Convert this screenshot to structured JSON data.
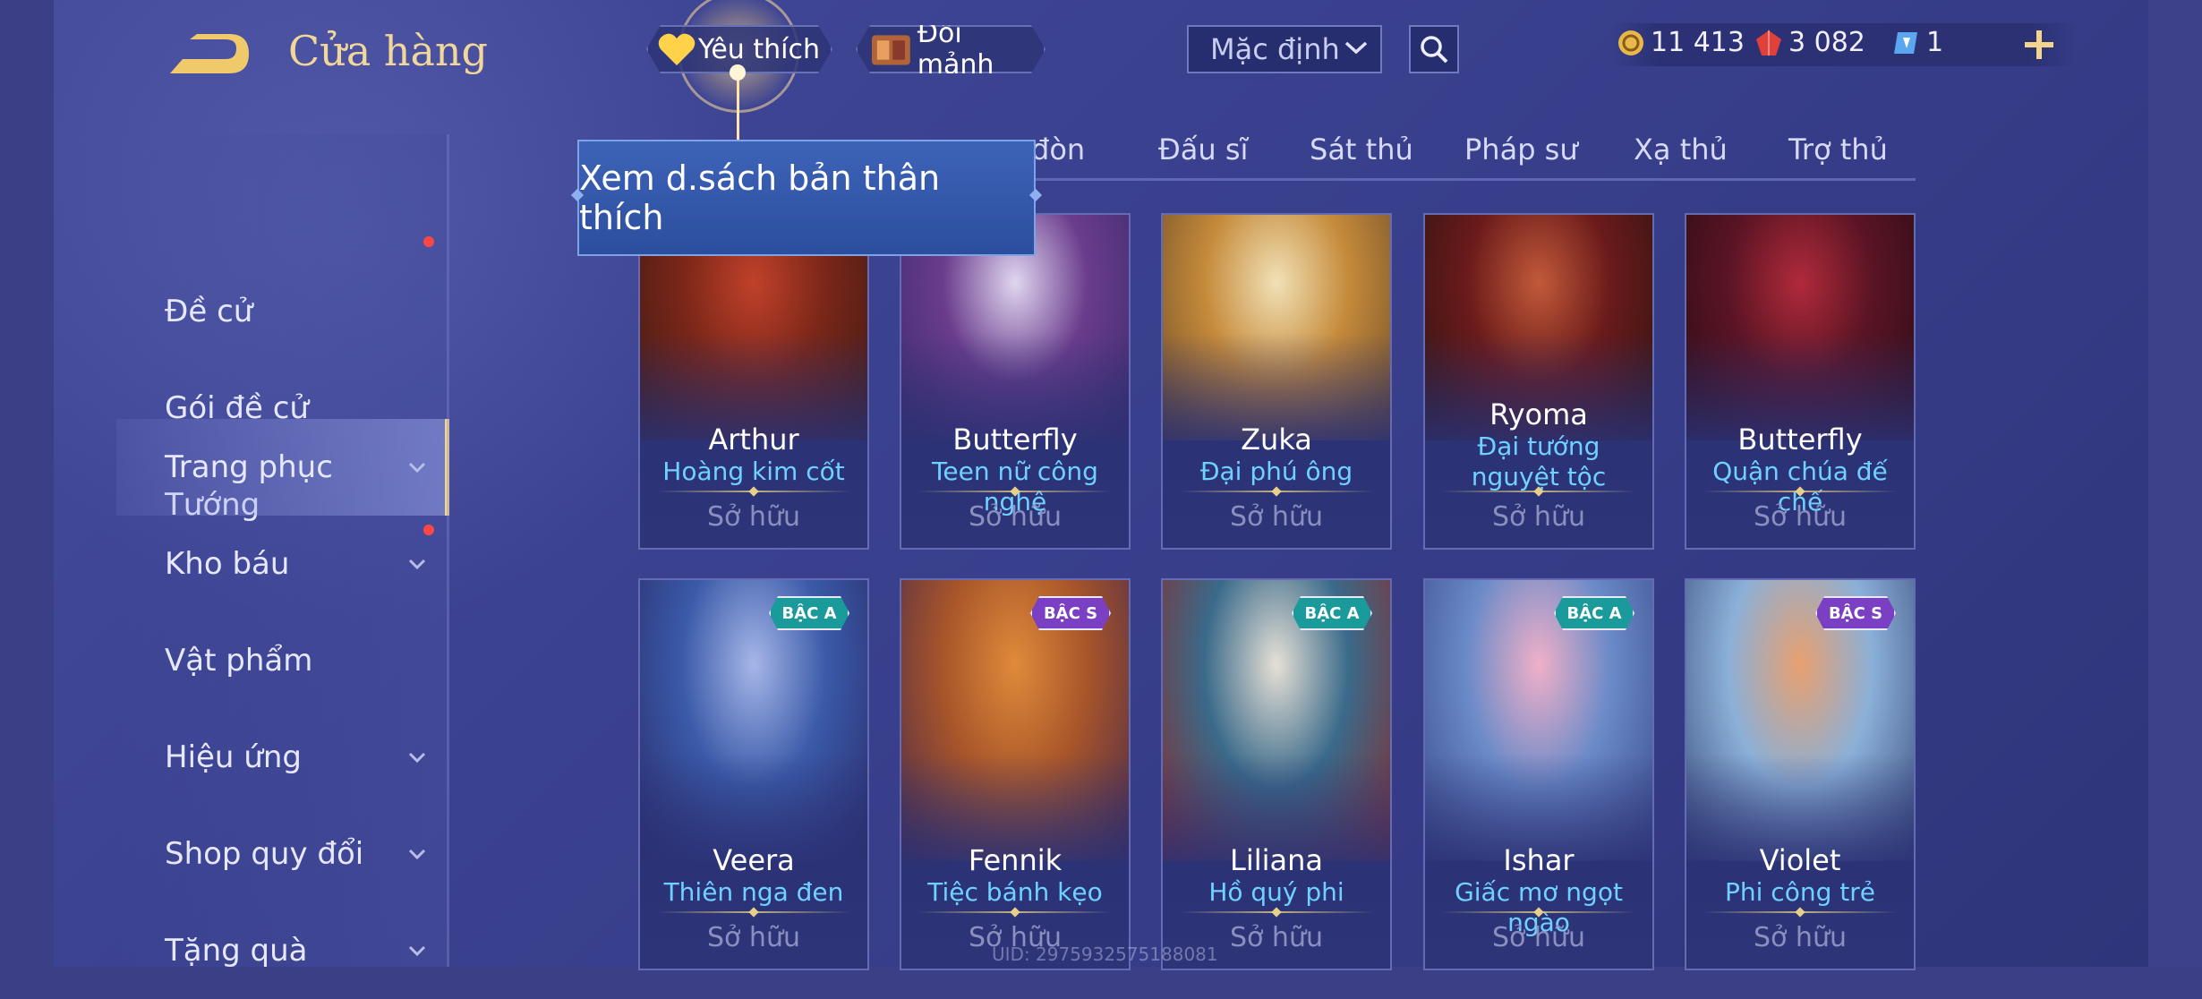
{
  "header": {
    "title": "Cửa hàng",
    "back_icon": "back-arrow-icon"
  },
  "topbar": {
    "favorite_label": "Yêu thích",
    "fragments_label": "Đổi mảnh",
    "sort_value": "Mặc định",
    "currency": {
      "gold": "11 413",
      "vouchers": "3 082",
      "tickets": "1"
    }
  },
  "sidebar": {
    "items": [
      {
        "label": "Đề cử"
      },
      {
        "label": "Gói đề cử"
      },
      {
        "label": "Tướng"
      },
      {
        "label": "Trang phục"
      },
      {
        "label": "Kho báu"
      },
      {
        "label": "Vật phẩm"
      },
      {
        "label": "Hiệu ứng"
      },
      {
        "label": "Shop quy đổi"
      },
      {
        "label": "Tặng quà"
      }
    ]
  },
  "tabs": {
    "items": [
      {
        "label": "đòn"
      },
      {
        "label": "Đấu sĩ"
      },
      {
        "label": "Sát thủ"
      },
      {
        "label": "Pháp sư"
      },
      {
        "label": "Xạ thủ"
      },
      {
        "label": "Trợ thủ"
      }
    ]
  },
  "tooltip": {
    "text": "Xem d.sách bản thân thích"
  },
  "cards": [
    {
      "hero": "Arthur",
      "skin": "Hoàng kim cốt",
      "status": "Sở hữu",
      "colors": [
        "#7a2618",
        "#c0412a",
        "#3b1a16"
      ]
    },
    {
      "hero": "Butterfly",
      "skin": "Teen nữ công nghệ",
      "status": "Sở hữu",
      "colors": [
        "#6a3c8c",
        "#e0d6f0",
        "#3a2a6a"
      ]
    },
    {
      "hero": "Zuka",
      "skin": "Đại phú ông",
      "status": "Sở hữu",
      "colors": [
        "#c58a3a",
        "#f1e1b6",
        "#6b4a2a"
      ]
    },
    {
      "hero": "Ryoma",
      "skin": "Đại tướng nguyệt tộc",
      "status": "Sở hữu",
      "colors": [
        "#6a1a1a",
        "#c25a3a",
        "#2a1414"
      ]
    },
    {
      "hero": "Butterfly",
      "skin": "Quận chúa đế chế",
      "status": "Sở hữu",
      "colors": [
        "#5a1424",
        "#b02a3a",
        "#2a0c16"
      ]
    },
    {
      "hero": "Veera",
      "skin": "Thiên nga đen",
      "status": "Sở hữu",
      "badge": "BẬC A",
      "colors": [
        "#3a5aa8",
        "#a6b6e8",
        "#2a2a6a"
      ]
    },
    {
      "hero": "Fennik",
      "skin": "Tiệc bánh kẹo",
      "status": "Sở hữu",
      "badge": "BẬC S",
      "colors": [
        "#a8552a",
        "#e08a3a",
        "#4a2a4a"
      ]
    },
    {
      "hero": "Liliana",
      "skin": "Hồ quý phi",
      "status": "Sở hữu",
      "badge": "BẬC A",
      "colors": [
        "#3a6a8a",
        "#e6e0d6",
        "#8a2a2a"
      ]
    },
    {
      "hero": "Ishar",
      "skin": "Giấc mơ ngọt ngào",
      "status": "Sở hữu",
      "badge": "BẬC A",
      "colors": [
        "#6a8ac8",
        "#f0b0c8",
        "#3a4a8a"
      ]
    },
    {
      "hero": "Violet",
      "skin": "Phi công trẻ",
      "status": "Sở hữu",
      "badge": "BẬC S",
      "colors": [
        "#8ab0d8",
        "#e8a070",
        "#3a4a7a"
      ]
    }
  ],
  "footer": {
    "uid": "UID: 2975932575188081"
  }
}
